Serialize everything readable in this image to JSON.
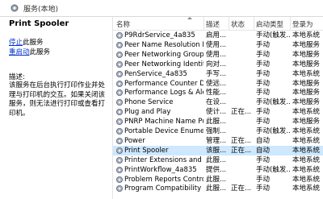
{
  "window": {
    "title": "服务(本地)"
  },
  "left_pane": {
    "service_name": "Print Spooler",
    "stop_link": "停止",
    "stop_rest": "此服务",
    "restart_link": "重启动",
    "restart_rest": "此服务",
    "desc_label": "描述:",
    "desc_text": "该服务在后台执行打印作业并处理与打印机的交互。如果关闭该服务，则无法进行打印或查看打印机。"
  },
  "table": {
    "headers": {
      "name": "名称",
      "desc": "描述",
      "status": "状态",
      "start": "启动类型",
      "logon": "登录为"
    },
    "rows": [
      {
        "name": "P9RdrService_4a835",
        "desc": "启用...",
        "status": "",
        "start": "手动(触发...",
        "logon": "本地系统"
      },
      {
        "name": "Peer Name Resolution Pr...",
        "desc": "使用...",
        "status": "",
        "start": "手动",
        "logon": "本地服务"
      },
      {
        "name": "Peer Networking Groupi...",
        "desc": "使用...",
        "status": "",
        "start": "手动",
        "logon": "本地服务"
      },
      {
        "name": "Peer Networking Identity...",
        "desc": "向对...",
        "status": "",
        "start": "手动",
        "logon": "本地服务"
      },
      {
        "name": "PenService_4a835",
        "desc": "手写...",
        "status": "",
        "start": "手动",
        "logon": "本地系统"
      },
      {
        "name": "Performance Counter DL...",
        "desc": "使远...",
        "status": "",
        "start": "手动",
        "logon": "本地服务"
      },
      {
        "name": "Performance Logs & Aler...",
        "desc": "性能...",
        "status": "",
        "start": "手动",
        "logon": "本地服务"
      },
      {
        "name": "Phone Service",
        "desc": "在设...",
        "status": "",
        "start": "手动(触发...",
        "logon": "本地服务"
      },
      {
        "name": "Plug and Play",
        "desc": "使计...",
        "status": "正在...",
        "start": "手动",
        "logon": "本地系统"
      },
      {
        "name": "PNRP Machine Name Pu...",
        "desc": "此服...",
        "status": "",
        "start": "手动",
        "logon": "本地服务"
      },
      {
        "name": "Portable Device Enumera...",
        "desc": "强制...",
        "status": "",
        "start": "手动(触发...",
        "logon": "本地系统"
      },
      {
        "name": "Power",
        "desc": "管理...",
        "status": "正在...",
        "start": "自动",
        "logon": "本地系统"
      },
      {
        "name": "Print Spooler",
        "desc": "该服...",
        "status": "正在...",
        "start": "自动",
        "logon": "本地系统"
      },
      {
        "name": "Printer Extensions and N...",
        "desc": "此服...",
        "status": "",
        "start": "手动",
        "logon": "本地系统"
      },
      {
        "name": "PrintWorkflow_4a835",
        "desc": "提供...",
        "status": "",
        "start": "手动(触发...",
        "logon": "本地系统"
      },
      {
        "name": "Problem Reports Control ...",
        "desc": "此服...",
        "status": "",
        "start": "手动",
        "logon": "本地系统"
      },
      {
        "name": "Program Compatibility A...",
        "desc": "此服...",
        "status": "正在...",
        "start": "手动",
        "logon": "本地系统"
      }
    ],
    "selected_index": 12
  },
  "colors": {
    "selection": "#cde8ff",
    "link": "#0033cc"
  },
  "icons": {
    "window": "services-gear-icon",
    "row": "gear-icon"
  }
}
